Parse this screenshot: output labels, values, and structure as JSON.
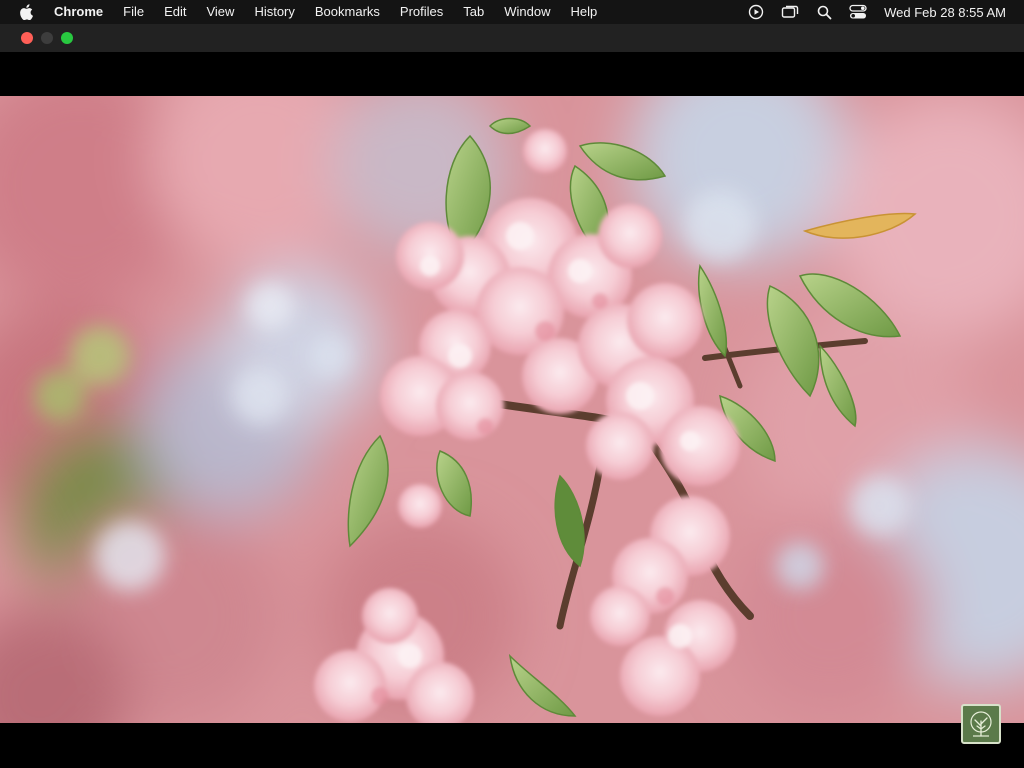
{
  "menubar": {
    "app_name": "Chrome",
    "items": [
      "File",
      "Edit",
      "View",
      "History",
      "Bookmarks",
      "Profiles",
      "Tab",
      "Window",
      "Help"
    ],
    "clock": "Wed Feb 28  8:55 AM",
    "status_icons": [
      "play-circle-icon",
      "screen-mirroring-icon",
      "spotlight-search-icon",
      "control-center-icon"
    ]
  },
  "window": {
    "traffic_lights": [
      "close",
      "minimize",
      "zoom"
    ]
  },
  "content": {
    "image_subject": "cherry-blossom-video",
    "watermark_icon": "tree-logo-icon"
  },
  "colors": {
    "menubar_bg": "#141414",
    "window_bar_bg": "#222222",
    "close": "#ff5f57",
    "zoom": "#28c840",
    "blossom_pink": "#f2c2c8"
  }
}
